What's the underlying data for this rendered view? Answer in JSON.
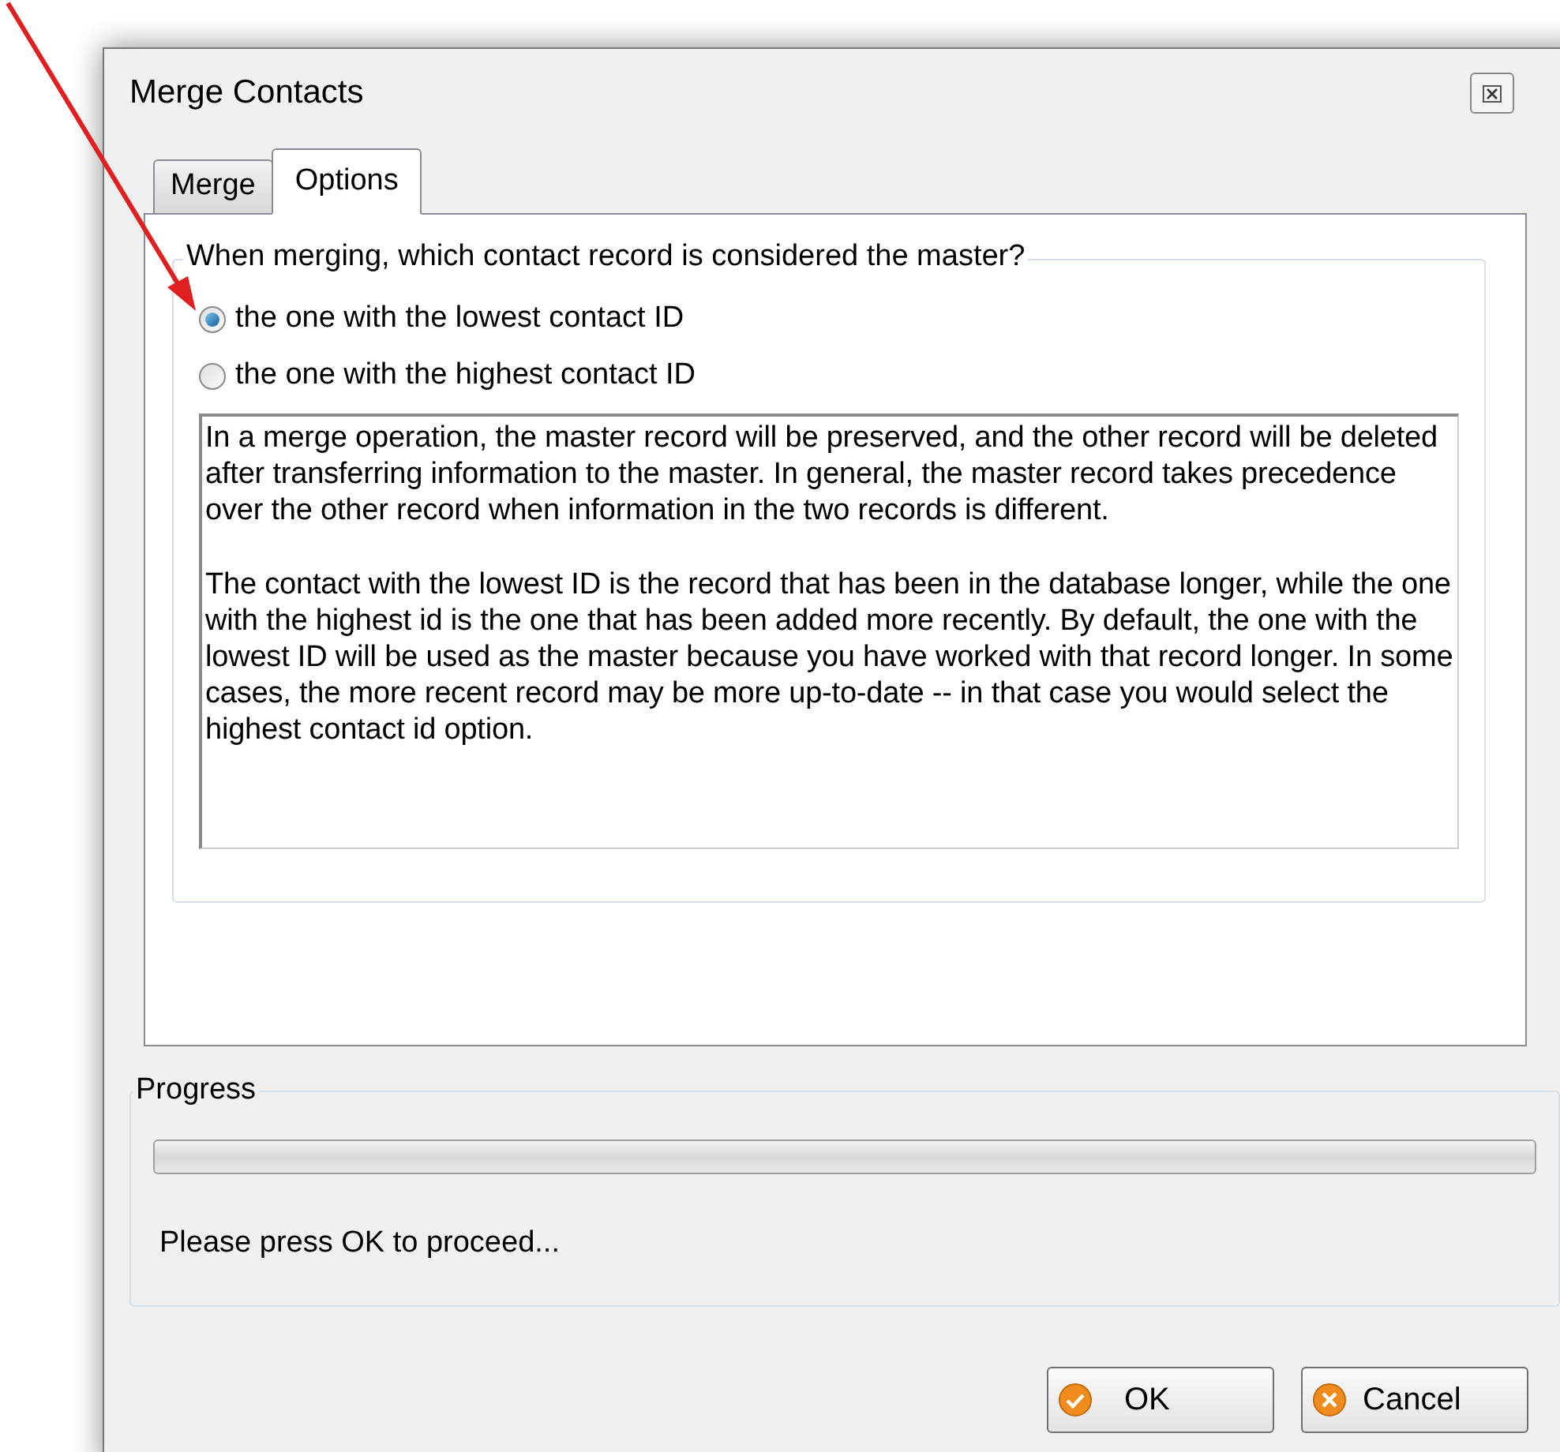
{
  "window": {
    "title": "Merge Contacts"
  },
  "tabs": [
    {
      "label": "Merge",
      "selected": false
    },
    {
      "label": "Options",
      "selected": true
    }
  ],
  "master_group": {
    "legend": "When merging, which contact record is considered the master?",
    "options": [
      {
        "label": "the one with the lowest contact ID",
        "selected": true
      },
      {
        "label": "the one with the highest contact ID",
        "selected": false
      }
    ],
    "description": [
      "In a merge operation, the master record will be preserved, and the other record will be deleted after transferring information to the master.  In general, the master record takes precedence over the other record when information in the two records is different.",
      "The contact with the lowest ID is the record that has been in the database longer, while the one with the highest id is the one that has been added more recently.  By default, the one with the lowest ID will be used as the master because you have worked with that record longer.  In some cases, the more recent record may be more up-to-date -- in that case you would select the highest contact id option."
    ]
  },
  "progress": {
    "legend": "Progress",
    "level": 0,
    "message": "Please press OK to proceed..."
  },
  "buttons": [
    {
      "label": "OK",
      "kind": "ok"
    },
    {
      "label": "Cancel",
      "kind": "cancel"
    }
  ]
}
